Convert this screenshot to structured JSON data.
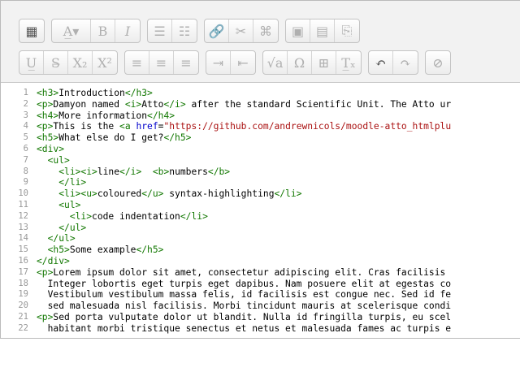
{
  "toolbar": {
    "row1": [
      {
        "name": "collapse-button",
        "icon": "keyboard-icon",
        "glyph": "▦",
        "dark": true
      },
      {
        "name": "style-button",
        "icon": "text-style-icon",
        "glyph": "A̲▾",
        "wide": true
      },
      {
        "name": "bold-button",
        "icon": "bold-icon",
        "glyph": "B"
      },
      {
        "name": "italic-button",
        "icon": "italic-icon",
        "glyph": "I",
        "italic": true
      },
      {
        "name": "unordered-list-button",
        "icon": "bullet-list-icon",
        "glyph": "☰"
      },
      {
        "name": "ordered-list-button",
        "icon": "numbered-list-icon",
        "glyph": "☷"
      },
      {
        "name": "link-button",
        "icon": "link-icon",
        "glyph": "🔗"
      },
      {
        "name": "unlink-button",
        "icon": "unlink-icon",
        "glyph": "✂"
      },
      {
        "name": "manage-files-button",
        "icon": "files-icon",
        "glyph": "⌘"
      },
      {
        "name": "image-button",
        "icon": "image-icon",
        "glyph": "▣"
      },
      {
        "name": "media-button",
        "icon": "film-icon",
        "glyph": "▤"
      },
      {
        "name": "paste-button",
        "icon": "clipboard-icon",
        "glyph": "⎘"
      }
    ],
    "row2": [
      {
        "name": "underline-button",
        "icon": "underline-icon",
        "glyph": "U̲"
      },
      {
        "name": "strikethrough-button",
        "icon": "strikethrough-icon",
        "glyph": "S̶"
      },
      {
        "name": "subscript-button",
        "icon": "subscript-icon",
        "glyph": "X₂"
      },
      {
        "name": "superscript-button",
        "icon": "superscript-icon",
        "glyph": "X²"
      },
      {
        "name": "align-left-button",
        "icon": "align-left-icon",
        "glyph": "≡"
      },
      {
        "name": "align-center-button",
        "icon": "align-center-icon",
        "glyph": "≡"
      },
      {
        "name": "align-right-button",
        "icon": "align-right-icon",
        "glyph": "≡"
      },
      {
        "name": "indent-button",
        "icon": "indent-icon",
        "glyph": "⇥"
      },
      {
        "name": "outdent-button",
        "icon": "outdent-icon",
        "glyph": "⇤"
      },
      {
        "name": "equation-button",
        "icon": "square-root-icon",
        "glyph": "√a"
      },
      {
        "name": "special-chars-button",
        "icon": "omega-icon",
        "glyph": "Ω"
      },
      {
        "name": "table-button",
        "icon": "table-icon",
        "glyph": "⊞"
      },
      {
        "name": "clear-format-button",
        "icon": "clear-format-icon",
        "glyph": "T̲ₓ"
      },
      {
        "name": "undo-button",
        "icon": "undo-icon",
        "glyph": "↶",
        "dark": true
      },
      {
        "name": "redo-button",
        "icon": "redo-icon",
        "glyph": "↷"
      },
      {
        "name": "accessibility-button",
        "icon": "accessibility-icon",
        "glyph": "⊘"
      }
    ]
  },
  "code_lines": [
    [
      {
        "t": "tag",
        "v": "<h3>"
      },
      {
        "t": "",
        "v": "Introduction"
      },
      {
        "t": "tag",
        "v": "</h3>"
      }
    ],
    [
      {
        "t": "tag",
        "v": "<p>"
      },
      {
        "t": "",
        "v": "Damyon named "
      },
      {
        "t": "tag",
        "v": "<i>"
      },
      {
        "t": "",
        "v": "Atto"
      },
      {
        "t": "tag",
        "v": "</i>"
      },
      {
        "t": "",
        "v": " after the standard Scientific Unit. The Atto ur"
      }
    ],
    [
      {
        "t": "tag",
        "v": "<h4>"
      },
      {
        "t": "",
        "v": "More information"
      },
      {
        "t": "tag",
        "v": "</h4>"
      }
    ],
    [
      {
        "t": "tag",
        "v": "<p>"
      },
      {
        "t": "",
        "v": "This is the "
      },
      {
        "t": "tag",
        "v": "<a "
      },
      {
        "t": "attr",
        "v": "href"
      },
      {
        "t": "",
        "v": "="
      },
      {
        "t": "str",
        "v": "\"https://github.com/andrewnicols/moodle-atto_htmlplu"
      }
    ],
    [
      {
        "t": "tag",
        "v": "<h5>"
      },
      {
        "t": "",
        "v": "What else do I get?"
      },
      {
        "t": "tag",
        "v": "</h5>"
      }
    ],
    [
      {
        "t": "tag",
        "v": "<div>"
      }
    ],
    [
      {
        "t": "",
        "v": "  "
      },
      {
        "t": "tag",
        "v": "<ul>"
      }
    ],
    [
      {
        "t": "",
        "v": "    "
      },
      {
        "t": "tag",
        "v": "<li><i>"
      },
      {
        "t": "",
        "v": "line"
      },
      {
        "t": "tag",
        "v": "</i>"
      },
      {
        "t": "",
        "v": "  "
      },
      {
        "t": "tag",
        "v": "<b>"
      },
      {
        "t": "",
        "v": "numbers"
      },
      {
        "t": "tag",
        "v": "</b>"
      }
    ],
    [
      {
        "t": "",
        "v": "    "
      },
      {
        "t": "tag",
        "v": "</li>"
      }
    ],
    [
      {
        "t": "",
        "v": "    "
      },
      {
        "t": "tag",
        "v": "<li><u>"
      },
      {
        "t": "",
        "v": "coloured"
      },
      {
        "t": "tag",
        "v": "</u>"
      },
      {
        "t": "",
        "v": " syntax-highlighting"
      },
      {
        "t": "tag",
        "v": "</li>"
      }
    ],
    [
      {
        "t": "",
        "v": "    "
      },
      {
        "t": "tag",
        "v": "<ul>"
      }
    ],
    [
      {
        "t": "",
        "v": "      "
      },
      {
        "t": "tag",
        "v": "<li>"
      },
      {
        "t": "",
        "v": "code indentation"
      },
      {
        "t": "tag",
        "v": "</li>"
      }
    ],
    [
      {
        "t": "",
        "v": "    "
      },
      {
        "t": "tag",
        "v": "</ul>"
      }
    ],
    [
      {
        "t": "",
        "v": "  "
      },
      {
        "t": "tag",
        "v": "</ul>"
      }
    ],
    [
      {
        "t": "",
        "v": "  "
      },
      {
        "t": "tag",
        "v": "<h5>"
      },
      {
        "t": "",
        "v": "Some example"
      },
      {
        "t": "tag",
        "v": "</h5>"
      }
    ],
    [
      {
        "t": "tag",
        "v": "</div>"
      }
    ],
    [
      {
        "t": "tag",
        "v": "<p>"
      },
      {
        "t": "",
        "v": "Lorem ipsum dolor sit amet, consectetur adipiscing elit. Cras facilisis"
      }
    ],
    [
      {
        "t": "",
        "v": "  Integer lobortis eget turpis eget dapibus. Nam posuere elit at egestas co"
      }
    ],
    [
      {
        "t": "",
        "v": "  Vestibulum vestibulum massa felis, id facilisis est congue nec. Sed id fe"
      }
    ],
    [
      {
        "t": "",
        "v": "  sed malesuada nisl facilisis. Morbi tincidunt mauris at scelerisque condi"
      }
    ],
    [
      {
        "t": "tag",
        "v": "<p>"
      },
      {
        "t": "",
        "v": "Sed porta vulputate dolor ut blandit. Nulla id fringilla turpis, eu scel"
      }
    ],
    [
      {
        "t": "",
        "v": "  habitant morbi tristique senectus et netus et malesuada fames ac turpis e"
      }
    ]
  ],
  "line_numbers": [
    "1",
    "2",
    "3",
    "4",
    "5",
    "6",
    "7",
    "8",
    "9",
    "10",
    "11",
    "12",
    "13",
    "14",
    "15",
    "16",
    "17",
    "18",
    "19",
    "20",
    "21",
    "22"
  ]
}
